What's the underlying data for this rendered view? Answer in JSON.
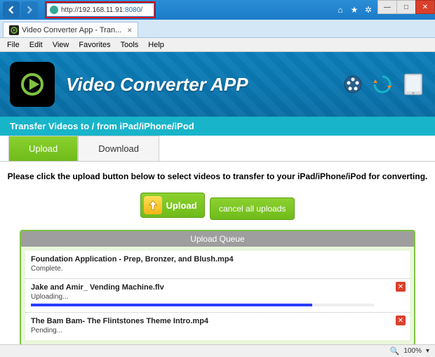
{
  "browser": {
    "url_prefix": "http://",
    "url_host": "192.168.11.91",
    "url_port": ":8080",
    "url_path": "/",
    "tab_title": "Video Converter App - Tran...",
    "menus": [
      "File",
      "Edit",
      "View",
      "Favorites",
      "Tools",
      "Help"
    ],
    "zoom": "100%"
  },
  "app": {
    "title": "Video Converter APP",
    "subtitle": "Transfer Videos to / from iPad/iPhone/iPod",
    "tabs": {
      "upload": "Upload",
      "download": "Download"
    },
    "instruction": "Please click the upload button below to select videos to transfer to your iPad/iPhone/iPod for converting.",
    "upload_btn": "Upload",
    "cancel_all_btn": "cancel all uploads",
    "queue_title": "Upload Queue",
    "queue": [
      {
        "name": "Foundation Application - Prep, Bronzer, and Blush.mp4",
        "status": "Complete.",
        "progress": 100,
        "has_cancel": false
      },
      {
        "name": "Jake and Amir_ Vending Machine.flv",
        "status": "Uploading...",
        "progress": 82,
        "has_cancel": true
      },
      {
        "name": "The Bam Bam- The Flintstones Theme Intro.mp4",
        "status": "Pending...",
        "progress": 0,
        "has_cancel": true
      }
    ]
  }
}
